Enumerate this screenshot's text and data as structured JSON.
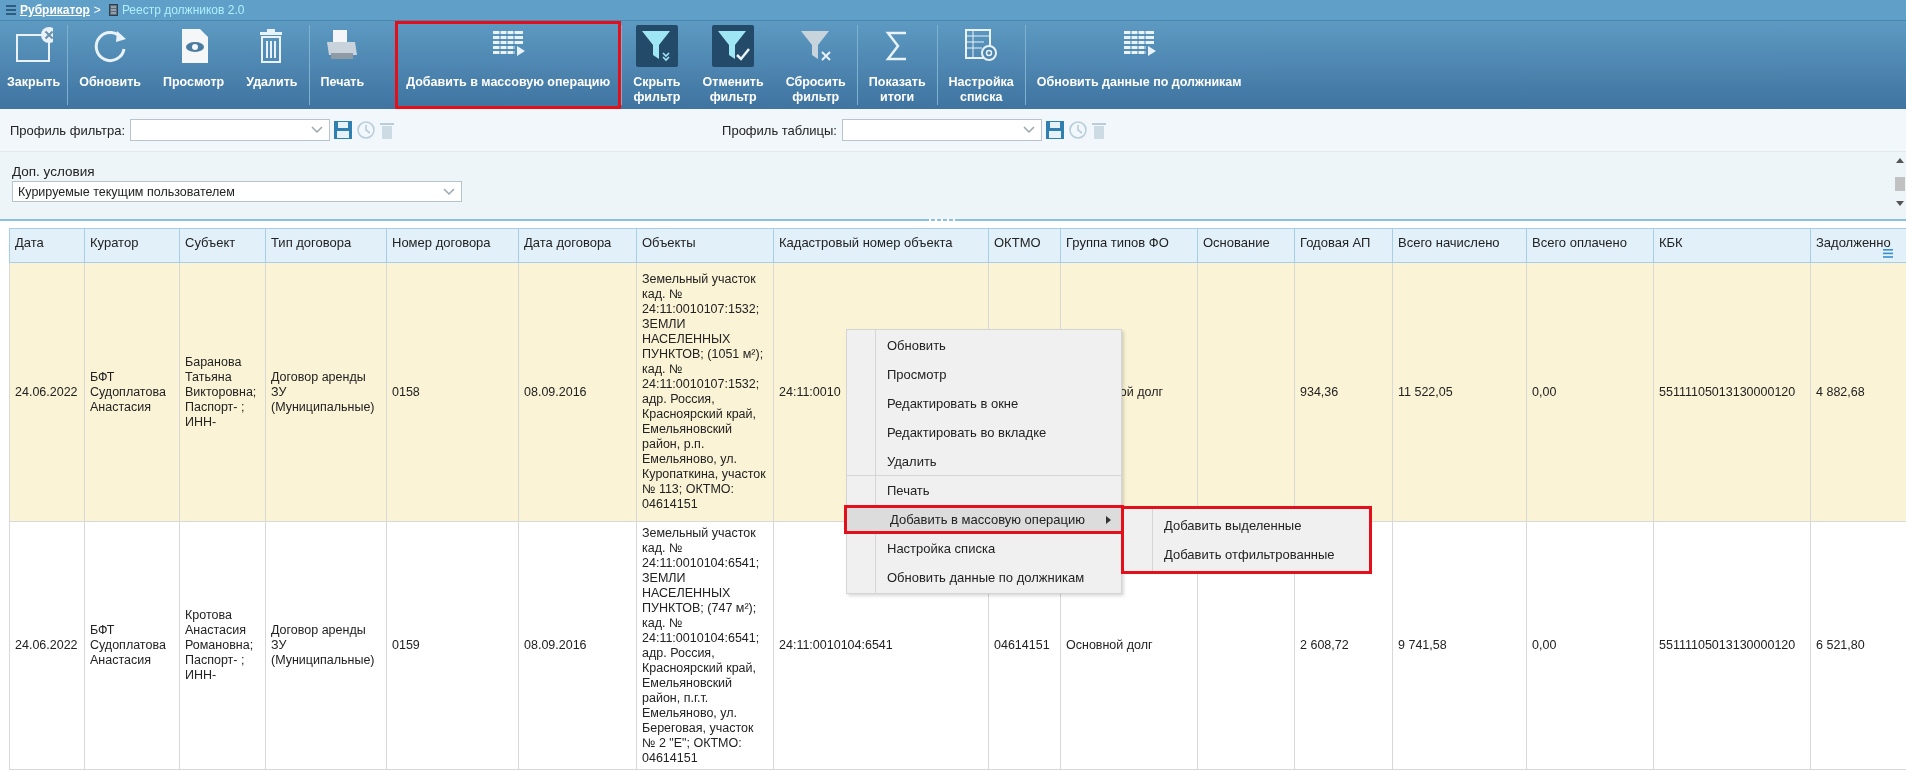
{
  "breadcrumb": {
    "parent": "Рубрикатор",
    "separator": ">",
    "current": "Реестр должников 2.0"
  },
  "toolbar": {
    "groups": [
      [
        {
          "label": "Закрыть",
          "highlighted": false,
          "active": false
        }
      ],
      [
        {
          "label": "Обновить",
          "highlighted": false,
          "active": false
        },
        {
          "label": "Просмотр",
          "highlighted": false,
          "active": false
        },
        {
          "label": "Удалить",
          "highlighted": false,
          "active": false
        }
      ],
      [
        {
          "label": "Печать",
          "highlighted": false,
          "active": false
        },
        {
          "label": "Добавить в массовую операцию",
          "highlighted": true,
          "active": false
        }
      ],
      [
        {
          "label": "Скрыть фильтр",
          "highlighted": false,
          "active": true
        },
        {
          "label": "Отменить фильтр",
          "highlighted": false,
          "active": true
        },
        {
          "label": "Сбросить фильтр",
          "highlighted": false,
          "active": false
        }
      ],
      [
        {
          "label": "Показать итоги",
          "highlighted": false,
          "active": false
        }
      ],
      [
        {
          "label": "Настройка списка",
          "highlighted": false,
          "active": false
        }
      ],
      [
        {
          "label": "Обновить данные по должникам",
          "highlighted": false,
          "active": false
        }
      ]
    ]
  },
  "filter_profile": {
    "label": "Профиль фильтра:"
  },
  "table_profile": {
    "label": "Профиль таблицы:"
  },
  "extra_conditions": {
    "label": "Доп. условия",
    "value": "Курируемые текущим пользователем"
  },
  "table": {
    "columns": [
      "Дата",
      "Куратор",
      "Субъект",
      "Тип договора",
      "Номер договора",
      "Дата договора",
      "Объекты",
      "Кадастровый номер объекта",
      "ОКТМО",
      "Группа типов ФО",
      "Основание",
      "Годовая АП",
      "Всего начислено",
      "Всего оплачено",
      "КБК",
      "Задолженно"
    ],
    "rows": [
      {
        "selected": true,
        "cells": [
          "24.06.2022",
          "БФТ Судоплатова Анастасия",
          "Баранова Татьяна Викторовна; Паспорт- ; ИНН-",
          "Договор аренды ЗУ (Муниципальные)",
          "0158",
          "08.09.2016",
          "Земельный участок кад. № 24:11:0010107:1532; ЗЕМЛИ НАСЕЛЕННЫХ ПУНКТОВ; (1051 м²); кад. № 24:11:0010107:1532; адр. Россия, Красноярский край, Емельяновский район, р.п. Емельяново, ул. Куропаткина, участок № 113; ОКТМО: 04614151",
          "24:11:0010",
          null,
          {
            "text": "ой долг",
            "clipped": true
          },
          null,
          "934,36",
          "11 522,05",
          "0,00",
          "55111105013130000120",
          "4 882,68"
        ]
      },
      {
        "selected": false,
        "cells": [
          "24.06.2022",
          "БФТ Судоплатова Анастасия",
          "Кротова Анастасия Романовна; Паспорт- ; ИНН-",
          "Договор аренды ЗУ (Муниципальные)",
          "0159",
          "08.09.2016",
          "Земельный участок кад. № 24:11:0010104:6541; ЗЕМЛИ НАСЕЛЕННЫХ ПУНКТОВ; (747 м²); кад. № 24:11:0010104:6541; адр. Россия, Красноярский край, Емельяновский район, п.г.т. Емельяново, ул. Береговая, участок № 2 \"Е\"; ОКТМО: 04614151",
          "24:11:0010104:6541",
          "04614151",
          "Основной долг",
          null,
          "2 608,72",
          "9 741,58",
          "0,00",
          "55111105013130000120",
          "6 521,80"
        ]
      }
    ]
  },
  "context_menu": {
    "items": [
      {
        "label": "Обновить",
        "highlighted": false,
        "separator_after": false,
        "has_submenu": false
      },
      {
        "label": "Просмотр",
        "highlighted": false,
        "separator_after": false,
        "has_submenu": false
      },
      {
        "label": "Редактировать в окне",
        "highlighted": false,
        "separator_after": false,
        "has_submenu": false
      },
      {
        "label": "Редактировать во вкладке",
        "highlighted": false,
        "separator_after": false,
        "has_submenu": false
      },
      {
        "label": "Удалить",
        "highlighted": false,
        "separator_after": true,
        "has_submenu": false
      },
      {
        "label": "Печать",
        "highlighted": false,
        "separator_after": false,
        "has_submenu": false
      },
      {
        "label": "Добавить в массовую операцию",
        "highlighted": true,
        "separator_after": false,
        "has_submenu": true
      },
      {
        "label": "Настройка списка",
        "highlighted": false,
        "separator_after": false,
        "has_submenu": false
      },
      {
        "label": "Обновить данные по должникам",
        "highlighted": false,
        "separator_after": false,
        "has_submenu": false
      }
    ],
    "submenu": {
      "highlighted": true,
      "items": [
        "Добавить выделенные",
        "Добавить отфильтрованные"
      ]
    }
  }
}
